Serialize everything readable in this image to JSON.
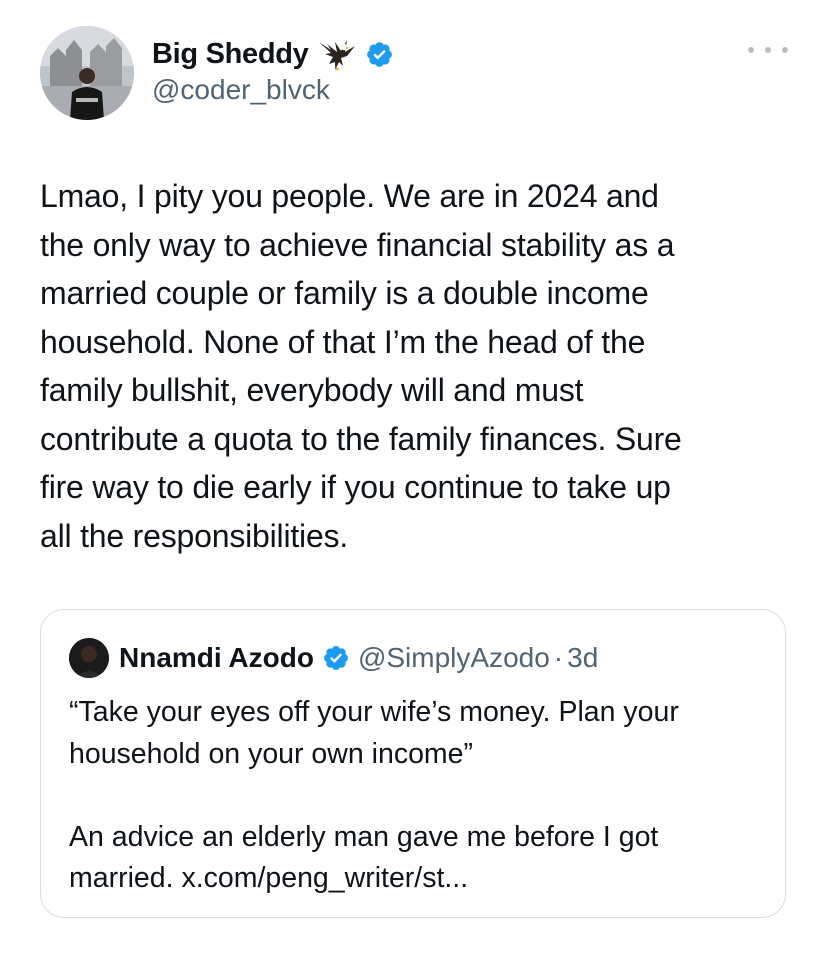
{
  "tweet": {
    "author": {
      "display_name": "Big Sheddy",
      "handle": "@coder_blvck",
      "emoji_icon": "eagle-icon",
      "verified": true
    },
    "text": "Lmao, I pity you people. We are in 2024 and\nthe only way to achieve financial stability as a\nmarried couple or family is a double income\nhousehold. None of that I’m the head of the\nfamily bullshit, everybody will and must\ncontribute a quota to the family finances. Sure\nfire way to die early if you continue to take up\nall the responsibilities.",
    "more_icon": "more-horizontal-icon"
  },
  "quote": {
    "author": {
      "display_name": "Nnamdi Azodo",
      "handle": "@SimplyAzodo",
      "separator": "·",
      "time": "3d",
      "verified": true
    },
    "text": "“Take your eyes off your wife’s money. Plan your\nhousehold on your own income”\n\nAn advice an elderly man gave me before I got\nmarried. x.com/peng_writer/st..."
  },
  "colors": {
    "text": "#0f1419",
    "secondary_text": "#536471",
    "verified_blue": "#1d9bf0",
    "border": "#d8dde1",
    "background": "#ffffff"
  }
}
